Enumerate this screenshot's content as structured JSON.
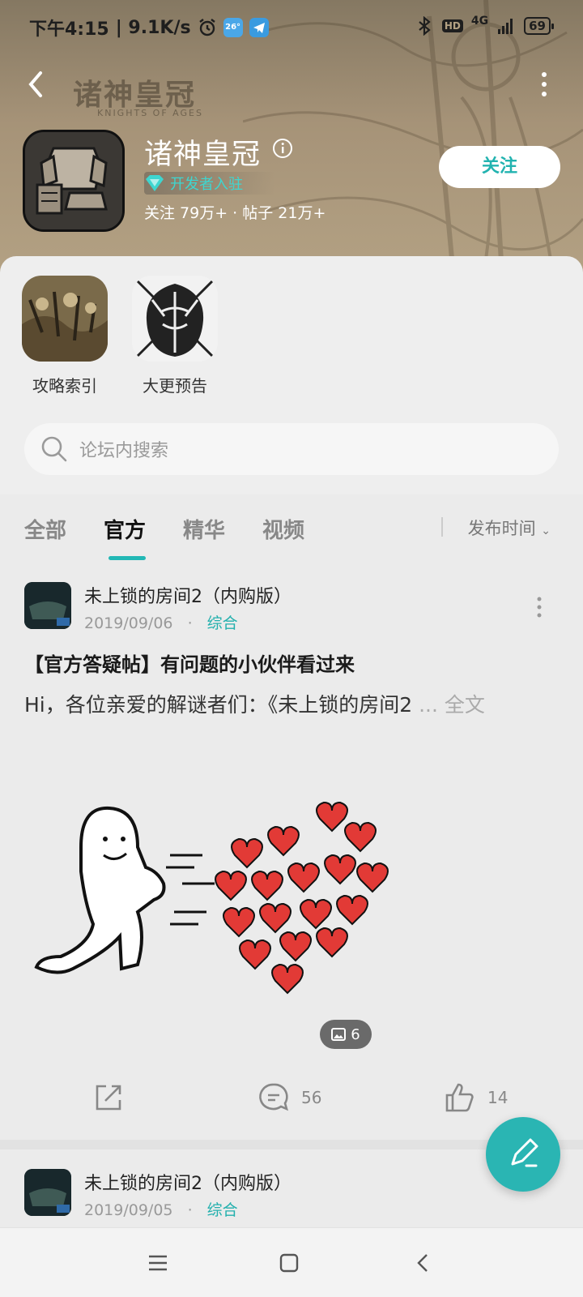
{
  "statusbar": {
    "time": "下午4:15",
    "speed": "| 9.1K/s",
    "weather": "26°",
    "network": "4G",
    "hd": "HD",
    "battery": "69"
  },
  "header": {
    "banner": "诸神皇冠",
    "banner_sub": "KNIGHTS OF AGES",
    "title": "诸神皇冠",
    "badge": "开发者入驻",
    "stats": "关注 79万+  ·  帖子 21万+",
    "follow_label": "关注"
  },
  "shortcuts": [
    {
      "label": "攻略索引"
    },
    {
      "label": "大更预告"
    }
  ],
  "search": {
    "placeholder": "论坛内搜索"
  },
  "tabs": [
    {
      "label": "全部"
    },
    {
      "label": "官方"
    },
    {
      "label": "精华"
    },
    {
      "label": "视频"
    }
  ],
  "sort_label": "发布时间",
  "posts": [
    {
      "author": "未上锁的房间2（内购版）",
      "date": "2019/09/06",
      "category": "综合",
      "title": "【官方答疑帖】有问题的小伙伴看过来",
      "excerpt": "Hi，各位亲爱的解谜者们：《未上锁的房间2",
      "more": "... 全文",
      "image_count": "6",
      "comments": "56",
      "likes": "14"
    },
    {
      "author": "未上锁的房间2（内购版）",
      "date": "2019/09/05",
      "category": "综合"
    }
  ],
  "colors": {
    "accent": "#22b8b5",
    "header": "#a69378"
  }
}
